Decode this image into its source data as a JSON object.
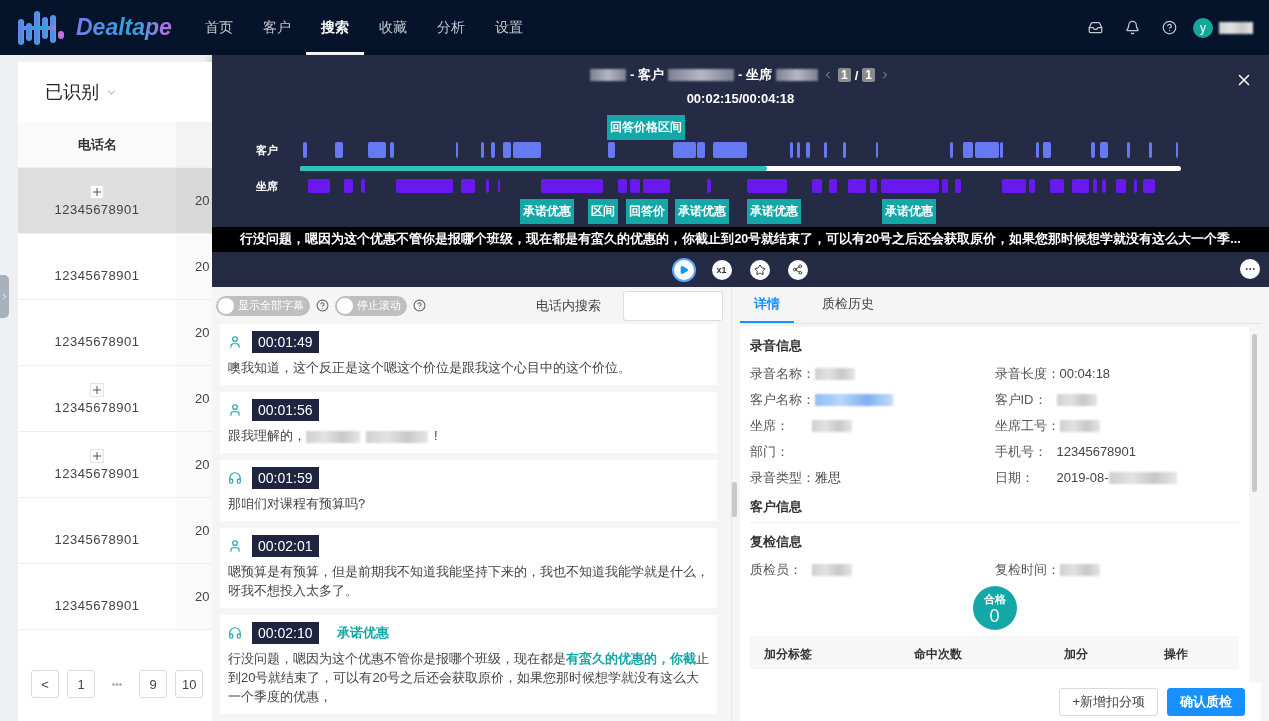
{
  "nav": {
    "logo": "Dealtape",
    "items": [
      {
        "label": "首页",
        "selected": false
      },
      {
        "label": "客户",
        "selected": false
      },
      {
        "label": "搜索",
        "selected": true
      },
      {
        "label": "收藏",
        "selected": false
      },
      {
        "label": "分析",
        "selected": false
      },
      {
        "label": "设置",
        "selected": false
      }
    ],
    "avatar": "y"
  },
  "left_panel": {
    "filter": "已识别",
    "column_1": "电话名",
    "rows": [
      {
        "phone": "12345678901",
        "column_2": "20",
        "expandable": true,
        "selected": true
      },
      {
        "phone": "12345678901",
        "column_2": "20",
        "expandable": false,
        "selected": false
      },
      {
        "phone": "12345678901",
        "column_2": "20",
        "expandable": false,
        "selected": false
      },
      {
        "phone": "12345678901",
        "column_2": "20",
        "expandable": true,
        "selected": false
      },
      {
        "phone": "12345678901",
        "column_2": "20",
        "expandable": true,
        "selected": false
      },
      {
        "phone": "12345678901",
        "column_2": "20",
        "expandable": false,
        "selected": false
      },
      {
        "phone": "12345678901",
        "column_2": "20",
        "expandable": false,
        "selected": false
      }
    ],
    "pagination": [
      {
        "label": "<",
        "kind": "button"
      },
      {
        "label": "1",
        "kind": "button"
      },
      {
        "label": "•••",
        "kind": "ellipsis"
      },
      {
        "label": "9",
        "kind": "button"
      },
      {
        "label": "10",
        "kind": "button"
      }
    ]
  },
  "player": {
    "title_customer": "- 客户",
    "title_agent": "- 坐席",
    "page": "1",
    "separator": "/",
    "pages": "1",
    "time": "00:02:15/00:04:18",
    "tracks": [
      {
        "label": "客户",
        "kind": "customer"
      },
      {
        "label": "坐席",
        "kind": "agent"
      }
    ],
    "level": 0.53,
    "tags_top": [
      {
        "label": "回答价格区间"
      }
    ],
    "tags_bottom": [
      {
        "label": "承诺优惠"
      },
      {
        "label": "区间"
      },
      {
        "label": "回答价"
      },
      {
        "label": "承诺优惠"
      },
      {
        "label": "承诺优惠"
      },
      {
        "label": "承诺优惠"
      }
    ],
    "subtitle": "行没问题，嗯因为这个优惠不管你是报哪个班级，现在都是有蛮久的优惠的，你截止到20号就结束了，可以有20号之后还会获取原价，如果您那时候想学就没有这么大一个季...",
    "speed": "x1"
  },
  "toolbar": {
    "toggles": [
      {
        "label": "显示全部字幕",
        "on": false
      },
      {
        "label": "停止滚动",
        "on": false
      }
    ],
    "search_label": "电话内搜索",
    "tabs": [
      {
        "label": "详情",
        "selected": true
      },
      {
        "label": "质检历史",
        "selected": false
      }
    ]
  },
  "transcript": [
    {
      "kind": "customer",
      "time": "00:01:49",
      "segments": [
        {
          "kind": "text",
          "text": "噢我知道，这个反正是这个嗯这个价位是跟我这个心目中的这个价位。"
        }
      ]
    },
    {
      "kind": "customer",
      "time": "00:01:56",
      "segments": [
        {
          "kind": "text",
          "text": "跟我理解的，"
        },
        {
          "kind": "redacted"
        },
        {
          "kind": "redacted"
        },
        {
          "kind": "text",
          "text": "!"
        }
      ]
    },
    {
      "kind": "agent",
      "time": "00:01:59",
      "segments": [
        {
          "kind": "text",
          "text": "那咱们对课程有预算吗?"
        }
      ]
    },
    {
      "kind": "customer",
      "time": "00:02:01",
      "segments": [
        {
          "kind": "text",
          "text": "嗯预算是有预算，但是前期我不知道我能坚持下来的，我也不知道我能学就是什么，呀我不想投入太多了。"
        }
      ]
    },
    {
      "kind": "agent",
      "time": "00:02:10",
      "tag": "承诺优惠",
      "segments": [
        {
          "kind": "text",
          "text": "行没问题，嗯因为这个优惠不管你是报哪个班级，现在都是"
        },
        {
          "kind": "highlight",
          "text": "有蛮久的优惠的，你截"
        },
        {
          "kind": "text",
          "text": "止到20号就结束了，可以有20号之后还会获取原价，如果您那时候想学就没有这么大一个季度的优惠，"
        }
      ]
    }
  ],
  "details": {
    "sections": [
      {
        "title": "录音信息",
        "fields": [
          {
            "label": "录音名称：",
            "kind": "redacted"
          },
          {
            "label": "录音长度：",
            "value": "00:04:18",
            "kind": "text"
          },
          {
            "label": "客户名称：",
            "kind": "redacted_link"
          },
          {
            "label": "客户ID：",
            "kind": "redacted"
          },
          {
            "label": "坐席：",
            "kind": "redacted"
          },
          {
            "label": "坐席工号：",
            "kind": "redacted"
          },
          {
            "label": "部门：",
            "kind": "empty"
          },
          {
            "label": "手机号：",
            "value": "12345678901",
            "kind": "text"
          },
          {
            "label": "录音类型：",
            "value": "雅思",
            "kind": "text"
          },
          {
            "label": "日期：",
            "value": "2019-08-",
            "kind": "partial"
          }
        ]
      },
      {
        "title": "客户信息"
      },
      {
        "title": "复检信息",
        "fields": [
          {
            "label": "质检员：",
            "kind": "redacted"
          },
          {
            "label": "复检时间：",
            "kind": "redacted"
          }
        ]
      }
    ],
    "score": {
      "label": "合格",
      "value": "0"
    },
    "table_columns": [
      "加分标签",
      "命中次数",
      "加分",
      "操作"
    ],
    "buttons": [
      {
        "label": "+新增扣分项",
        "kind": "secondary"
      },
      {
        "label": "确认质检",
        "kind": "primary"
      }
    ]
  }
}
